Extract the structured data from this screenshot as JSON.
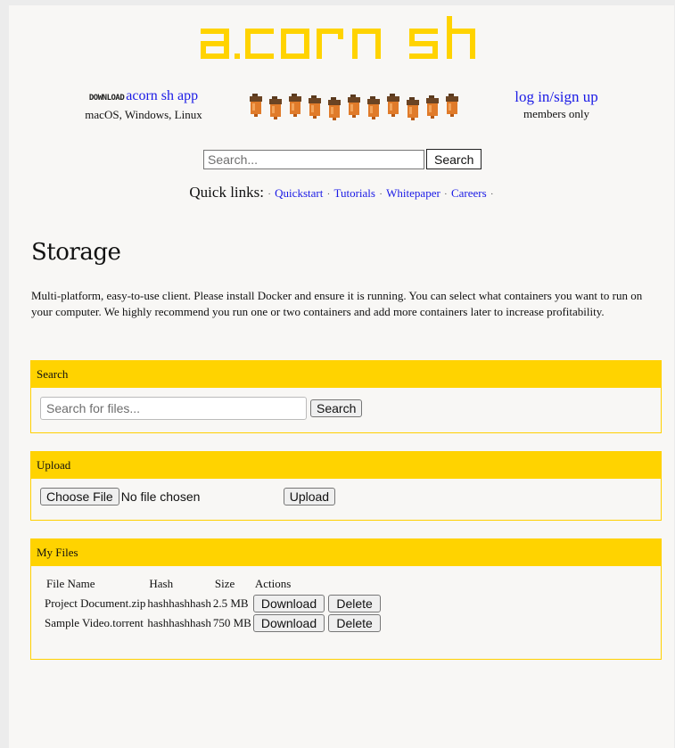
{
  "header": {
    "logo_text": "acorn sh",
    "download_tag": "DOWNLOAD",
    "download_link": "acorn sh app",
    "download_platforms": "macOS, Windows, Linux",
    "login_link": "log in/sign up",
    "login_note": "members only",
    "acorn_count": 11
  },
  "top_search": {
    "placeholder": "Search...",
    "button": "Search"
  },
  "quick_links": {
    "label": "Quick links:",
    "items": [
      "Quickstart",
      "Tutorials",
      "Whitepaper",
      "Careers"
    ]
  },
  "page_title": "Storage",
  "intro": "Multi-platform, easy-to-use client. Please install Docker and ensure it is running. You can select what containers you want to run on your computer. We highly recommend you run one or two containers and add more containers later to increase profitability.",
  "search_panel": {
    "title": "Search",
    "placeholder": "Search for files...",
    "button": "Search"
  },
  "upload_panel": {
    "title": "Upload",
    "choose_button": "Choose File",
    "no_file": "No file chosen",
    "upload_button": "Upload"
  },
  "files_panel": {
    "title": "My Files",
    "columns": [
      "File Name",
      "Hash",
      "Size",
      "Actions"
    ],
    "rows": [
      {
        "name": "Project Document.zip",
        "hash": "hashhashhash",
        "size": "2.5 MB"
      },
      {
        "name": "Sample Video.torrent",
        "hash": "hashhashhash",
        "size": "750 MB"
      }
    ],
    "download_label": "Download",
    "delete_label": "Delete"
  },
  "colors": {
    "accent_yellow": "#ffd300",
    "link_blue": "#1a1ae6",
    "acorn_orange": "#e07b2a"
  }
}
